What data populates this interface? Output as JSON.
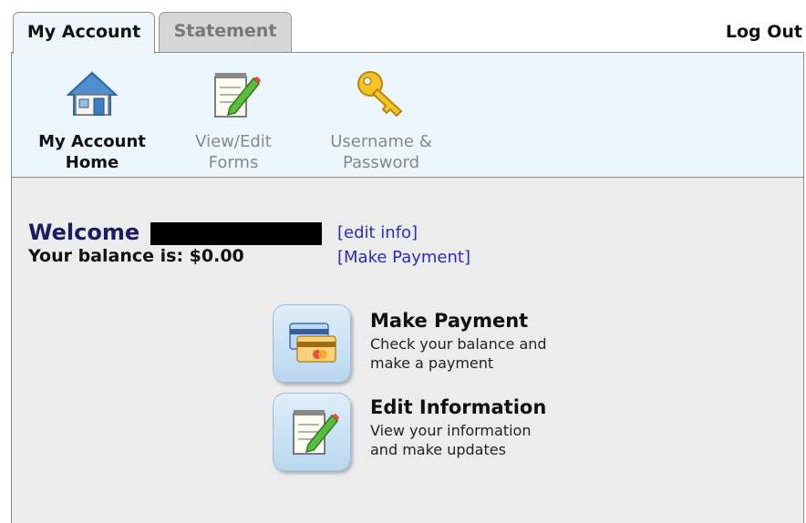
{
  "tabs": [
    {
      "label": "My Account",
      "active": true
    },
    {
      "label": "Statement",
      "active": false
    }
  ],
  "header": {
    "logout_label": "Log Out"
  },
  "subnav": {
    "items": [
      {
        "line1": "My Account",
        "line2": "Home",
        "icon": "house-icon",
        "active": true
      },
      {
        "line1": "View/Edit",
        "line2": "Forms",
        "icon": "notepad-pencil-icon",
        "active": false
      },
      {
        "line1": "Username &",
        "line2": "Password",
        "icon": "key-icon",
        "active": false
      }
    ]
  },
  "main": {
    "welcome_label": "Welcome",
    "balance_text": "Your balance is: $0.00",
    "edit_info_link": "[edit info]",
    "make_payment_link": "[Make Payment]",
    "actions": [
      {
        "title": "Make Payment",
        "desc_line1": "Check your balance and",
        "desc_line2": "make a payment",
        "icon": "credit-card-icon"
      },
      {
        "title": "Edit Information",
        "desc_line1": "View your information",
        "desc_line2": "and make updates",
        "icon": "notepad-pencil-icon"
      }
    ]
  },
  "colors": {
    "subnav_bg": "#ecf6fc",
    "main_bg": "#ececec",
    "link": "#2b2bbd",
    "welcome": "#1a1a66"
  }
}
